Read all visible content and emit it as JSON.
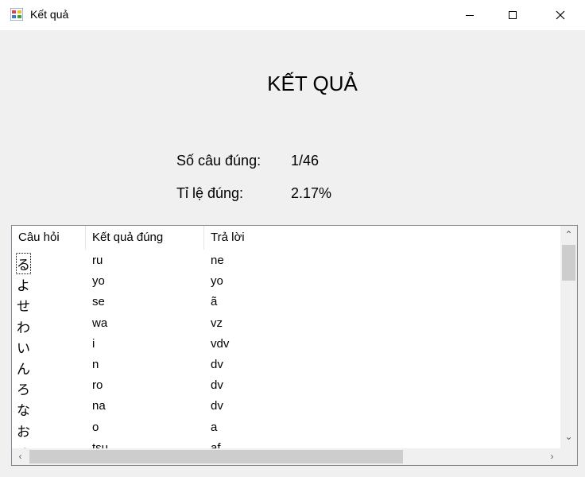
{
  "window": {
    "title": "Kết quả"
  },
  "heading": "KẾT QUẢ",
  "stats": {
    "correct_label": "Số câu đúng:",
    "correct_value": "1/46",
    "rate_label": "Tỉ lệ đúng:",
    "rate_value": "2.17%"
  },
  "table": {
    "headers": [
      "Câu hỏi",
      "Kết quả đúng",
      "Trả lời"
    ],
    "rows": [
      [
        "る",
        "ru",
        "ne"
      ],
      [
        "よ",
        "yo",
        "yo"
      ],
      [
        "せ",
        "se",
        "ã"
      ],
      [
        "わ",
        "wa",
        "vz"
      ],
      [
        "い",
        "i",
        "vdv"
      ],
      [
        "ん",
        "n",
        "dv"
      ],
      [
        "ろ",
        "ro",
        "dv"
      ],
      [
        "な",
        "na",
        "dv"
      ],
      [
        "お",
        "o",
        "a"
      ],
      [
        "つ",
        "tsu",
        "af"
      ]
    ]
  }
}
